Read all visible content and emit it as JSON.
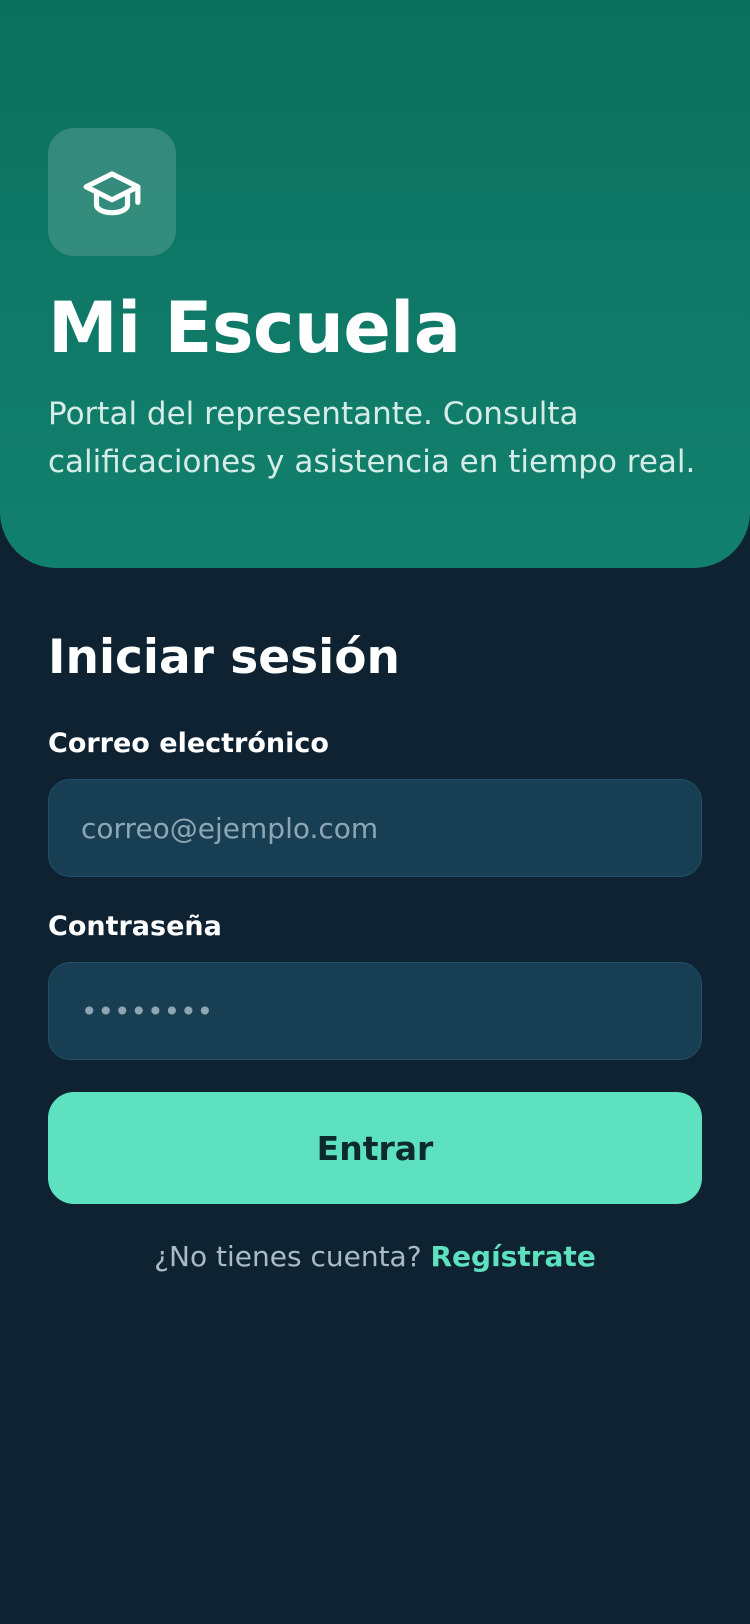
{
  "colors": {
    "hero_background": "#0c705e",
    "page_background": "#0e2231",
    "input_background": "#173e52",
    "accent": "#5de1bf",
    "button_text": "#0d2a2c"
  },
  "hero": {
    "logo_icon": "graduation-cap-icon",
    "title": "Mi Escuela",
    "subtitle": "Portal del representante. Consulta calificaciones y asistencia en tiempo real."
  },
  "login": {
    "title": "Iniciar sesión",
    "email": {
      "label": "Correo electrónico",
      "placeholder": "correo@ejemplo.com",
      "value": ""
    },
    "password": {
      "label": "Contraseña",
      "placeholder": "••••••••",
      "value": ""
    },
    "submit_label": "Entrar",
    "signup_prompt": "¿No tienes cuenta?",
    "signup_link": "Regístrate"
  }
}
